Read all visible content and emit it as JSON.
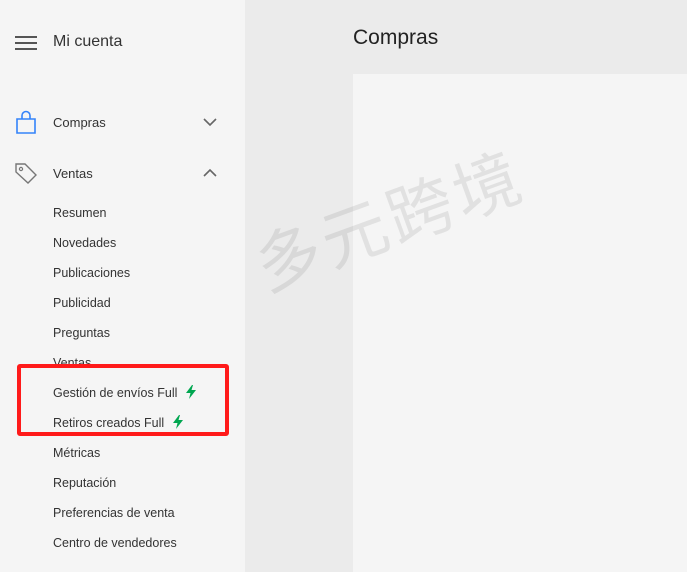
{
  "sidebar": {
    "account_title": "Mi cuenta",
    "sections": [
      {
        "label": "Compras",
        "icon": "shopping-bag-icon",
        "expanded": false
      },
      {
        "label": "Ventas",
        "icon": "tag-icon",
        "expanded": true
      }
    ],
    "ventas_items": [
      "Resumen",
      "Novedades",
      "Publicaciones",
      "Publicidad",
      "Preguntas",
      "Ventas",
      "Gestión de envíos Full",
      "Retiros creados Full",
      "Métricas",
      "Reputación",
      "Preferencias de venta",
      "Centro de vendedores"
    ]
  },
  "main": {
    "title": "Compras"
  },
  "watermark": "多元跨境",
  "colors": {
    "accent_blue": "#3483fa",
    "full_green": "#00a650",
    "highlight_red": "#ff1a1a"
  }
}
